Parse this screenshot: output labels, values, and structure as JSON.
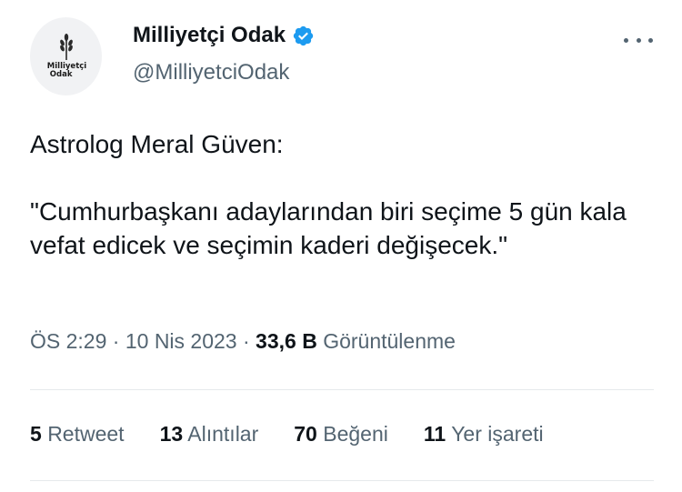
{
  "tweet": {
    "avatar": {
      "logo_line1": "Milliyetçi",
      "logo_line2": "Odak",
      "icon": "wheat-icon"
    },
    "display_name": "Milliyetçi Odak",
    "verified_icon": "verified-badge-icon",
    "handle": "@MilliyetciOdak",
    "more_icon": "more-options-icon",
    "text": "Astrolog Meral Güven:\n\n\"Cumhurbaşkanı adaylarından biri seçime 5 gün kala vefat edicek ve seçimin kaderi değişecek.\"",
    "time": "ÖS 2:29",
    "separator": "·",
    "date": "10 Nis 2023",
    "views_count": "33,6 B",
    "views_label": "Görüntülenme",
    "stats": {
      "retweets": {
        "count": "5",
        "label": "Retweet"
      },
      "quotes": {
        "count": "13",
        "label": "Alıntılar"
      },
      "likes": {
        "count": "70",
        "label": "Beğeni"
      },
      "bookmarks": {
        "count": "11",
        "label": "Yer işareti"
      }
    }
  },
  "colors": {
    "text": "#0f1419",
    "secondary": "#536471",
    "verified": "#1d9bf0",
    "divider": "#e6e9ec"
  }
}
